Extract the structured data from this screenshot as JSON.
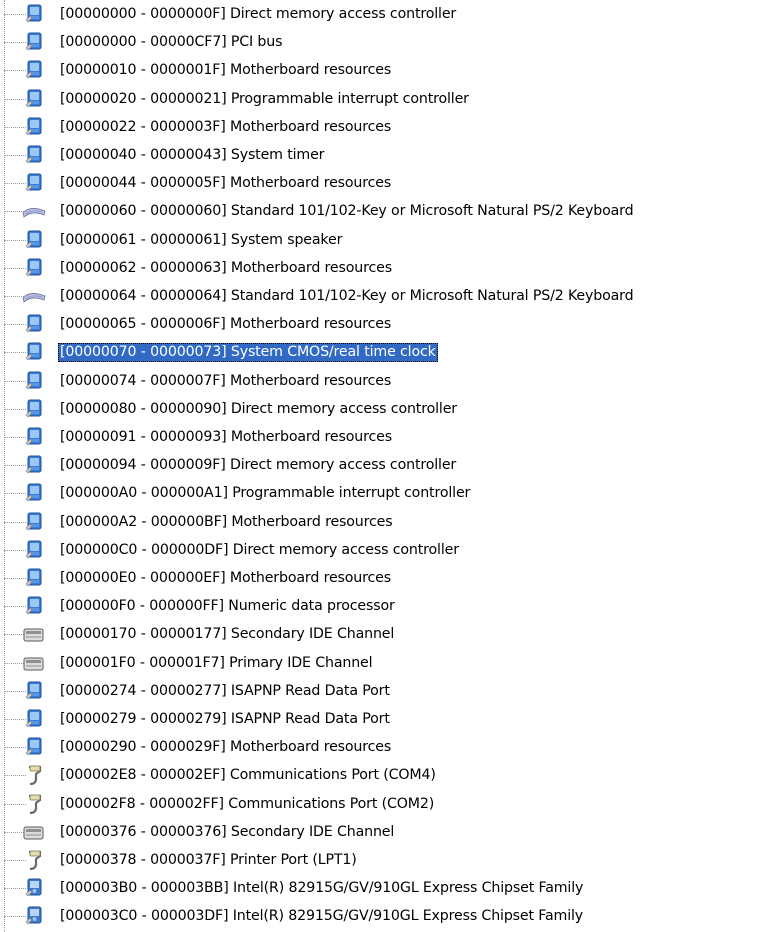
{
  "window_title": "",
  "tree": {
    "items": [
      {
        "label": "[00000000 - 0000000F]  Direct memory access controller",
        "icon": "system-device-icon"
      },
      {
        "label": "[00000000 - 00000CF7]  PCI bus",
        "icon": "system-device-icon"
      },
      {
        "label": "[00000010 - 0000001F]  Motherboard resources",
        "icon": "system-device-icon"
      },
      {
        "label": "[00000020 - 00000021]  Programmable interrupt controller",
        "icon": "system-device-icon"
      },
      {
        "label": "[00000022 - 0000003F]  Motherboard resources",
        "icon": "system-device-icon"
      },
      {
        "label": "[00000040 - 00000043]  System timer",
        "icon": "system-device-icon"
      },
      {
        "label": "[00000044 - 0000005F]  Motherboard resources",
        "icon": "system-device-icon"
      },
      {
        "label": "[00000060 - 00000060]  Standard 101/102-Key or Microsoft Natural PS/2 Keyboard",
        "icon": "keyboard-icon"
      },
      {
        "label": "[00000061 - 00000061]  System speaker",
        "icon": "system-device-icon"
      },
      {
        "label": "[00000062 - 00000063]  Motherboard resources",
        "icon": "system-device-icon"
      },
      {
        "label": "[00000064 - 00000064]  Standard 101/102-Key or Microsoft Natural PS/2 Keyboard",
        "icon": "keyboard-icon"
      },
      {
        "label": "[00000065 - 0000006F]  Motherboard resources",
        "icon": "system-device-icon"
      },
      {
        "label": "[00000070 - 00000073]  System CMOS/real time clock",
        "icon": "system-device-icon",
        "selected": true
      },
      {
        "label": "[00000074 - 0000007F]  Motherboard resources",
        "icon": "system-device-icon"
      },
      {
        "label": "[00000080 - 00000090]  Direct memory access controller",
        "icon": "system-device-icon"
      },
      {
        "label": "[00000091 - 00000093]  Motherboard resources",
        "icon": "system-device-icon"
      },
      {
        "label": "[00000094 - 0000009F]  Direct memory access controller",
        "icon": "system-device-icon"
      },
      {
        "label": "[000000A0 - 000000A1]  Programmable interrupt controller",
        "icon": "system-device-icon"
      },
      {
        "label": "[000000A2 - 000000BF]  Motherboard resources",
        "icon": "system-device-icon"
      },
      {
        "label": "[000000C0 - 000000DF]  Direct memory access controller",
        "icon": "system-device-icon"
      },
      {
        "label": "[000000E0 - 000000EF]  Motherboard resources",
        "icon": "system-device-icon"
      },
      {
        "label": "[000000F0 - 000000FF]  Numeric data processor",
        "icon": "system-device-icon"
      },
      {
        "label": "[00000170 - 00000177]  Secondary IDE Channel",
        "icon": "ide-controller-icon"
      },
      {
        "label": "[000001F0 - 000001F7]  Primary IDE Channel",
        "icon": "ide-controller-icon"
      },
      {
        "label": "[00000274 - 00000277]  ISAPNP Read Data Port",
        "icon": "system-device-icon"
      },
      {
        "label": "[00000279 - 00000279]  ISAPNP Read Data Port",
        "icon": "system-device-icon"
      },
      {
        "label": "[00000290 - 0000029F]  Motherboard resources",
        "icon": "system-device-icon"
      },
      {
        "label": "[000002E8 - 000002EF]  Communications Port (COM4)",
        "icon": "port-icon"
      },
      {
        "label": "[000002F8 - 000002FF]  Communications Port (COM2)",
        "icon": "port-icon"
      },
      {
        "label": "[00000376 - 00000376]  Secondary IDE Channel",
        "icon": "ide-controller-icon"
      },
      {
        "label": "[00000378 - 0000037F]  Printer Port (LPT1)",
        "icon": "port-icon"
      },
      {
        "label": "[000003B0 - 000003BB]  Intel(R) 82915G/GV/910GL Express Chipset Family",
        "icon": "display-adapter-icon"
      },
      {
        "label": "[000003C0 - 000003DF]  Intel(R) 82915G/GV/910GL Express Chipset Family",
        "icon": "display-adapter-icon"
      }
    ]
  },
  "colors": {
    "selection_bg": "#316ac5",
    "selection_text": "#ffffff",
    "tree_line": "#9a9a9a"
  }
}
